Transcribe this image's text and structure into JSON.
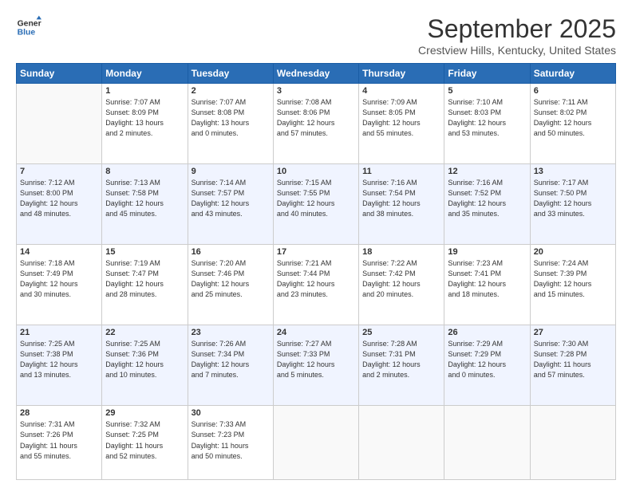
{
  "header": {
    "logo_line1": "General",
    "logo_line2": "Blue",
    "month": "September 2025",
    "location": "Crestview Hills, Kentucky, United States"
  },
  "weekdays": [
    "Sunday",
    "Monday",
    "Tuesday",
    "Wednesday",
    "Thursday",
    "Friday",
    "Saturday"
  ],
  "weeks": [
    [
      {
        "day": "",
        "info": ""
      },
      {
        "day": "1",
        "info": "Sunrise: 7:07 AM\nSunset: 8:09 PM\nDaylight: 13 hours\nand 2 minutes."
      },
      {
        "day": "2",
        "info": "Sunrise: 7:07 AM\nSunset: 8:08 PM\nDaylight: 13 hours\nand 0 minutes."
      },
      {
        "day": "3",
        "info": "Sunrise: 7:08 AM\nSunset: 8:06 PM\nDaylight: 12 hours\nand 57 minutes."
      },
      {
        "day": "4",
        "info": "Sunrise: 7:09 AM\nSunset: 8:05 PM\nDaylight: 12 hours\nand 55 minutes."
      },
      {
        "day": "5",
        "info": "Sunrise: 7:10 AM\nSunset: 8:03 PM\nDaylight: 12 hours\nand 53 minutes."
      },
      {
        "day": "6",
        "info": "Sunrise: 7:11 AM\nSunset: 8:02 PM\nDaylight: 12 hours\nand 50 minutes."
      }
    ],
    [
      {
        "day": "7",
        "info": "Sunrise: 7:12 AM\nSunset: 8:00 PM\nDaylight: 12 hours\nand 48 minutes."
      },
      {
        "day": "8",
        "info": "Sunrise: 7:13 AM\nSunset: 7:58 PM\nDaylight: 12 hours\nand 45 minutes."
      },
      {
        "day": "9",
        "info": "Sunrise: 7:14 AM\nSunset: 7:57 PM\nDaylight: 12 hours\nand 43 minutes."
      },
      {
        "day": "10",
        "info": "Sunrise: 7:15 AM\nSunset: 7:55 PM\nDaylight: 12 hours\nand 40 minutes."
      },
      {
        "day": "11",
        "info": "Sunrise: 7:16 AM\nSunset: 7:54 PM\nDaylight: 12 hours\nand 38 minutes."
      },
      {
        "day": "12",
        "info": "Sunrise: 7:16 AM\nSunset: 7:52 PM\nDaylight: 12 hours\nand 35 minutes."
      },
      {
        "day": "13",
        "info": "Sunrise: 7:17 AM\nSunset: 7:50 PM\nDaylight: 12 hours\nand 33 minutes."
      }
    ],
    [
      {
        "day": "14",
        "info": "Sunrise: 7:18 AM\nSunset: 7:49 PM\nDaylight: 12 hours\nand 30 minutes."
      },
      {
        "day": "15",
        "info": "Sunrise: 7:19 AM\nSunset: 7:47 PM\nDaylight: 12 hours\nand 28 minutes."
      },
      {
        "day": "16",
        "info": "Sunrise: 7:20 AM\nSunset: 7:46 PM\nDaylight: 12 hours\nand 25 minutes."
      },
      {
        "day": "17",
        "info": "Sunrise: 7:21 AM\nSunset: 7:44 PM\nDaylight: 12 hours\nand 23 minutes."
      },
      {
        "day": "18",
        "info": "Sunrise: 7:22 AM\nSunset: 7:42 PM\nDaylight: 12 hours\nand 20 minutes."
      },
      {
        "day": "19",
        "info": "Sunrise: 7:23 AM\nSunset: 7:41 PM\nDaylight: 12 hours\nand 18 minutes."
      },
      {
        "day": "20",
        "info": "Sunrise: 7:24 AM\nSunset: 7:39 PM\nDaylight: 12 hours\nand 15 minutes."
      }
    ],
    [
      {
        "day": "21",
        "info": "Sunrise: 7:25 AM\nSunset: 7:38 PM\nDaylight: 12 hours\nand 13 minutes."
      },
      {
        "day": "22",
        "info": "Sunrise: 7:25 AM\nSunset: 7:36 PM\nDaylight: 12 hours\nand 10 minutes."
      },
      {
        "day": "23",
        "info": "Sunrise: 7:26 AM\nSunset: 7:34 PM\nDaylight: 12 hours\nand 7 minutes."
      },
      {
        "day": "24",
        "info": "Sunrise: 7:27 AM\nSunset: 7:33 PM\nDaylight: 12 hours\nand 5 minutes."
      },
      {
        "day": "25",
        "info": "Sunrise: 7:28 AM\nSunset: 7:31 PM\nDaylight: 12 hours\nand 2 minutes."
      },
      {
        "day": "26",
        "info": "Sunrise: 7:29 AM\nSunset: 7:29 PM\nDaylight: 12 hours\nand 0 minutes."
      },
      {
        "day": "27",
        "info": "Sunrise: 7:30 AM\nSunset: 7:28 PM\nDaylight: 11 hours\nand 57 minutes."
      }
    ],
    [
      {
        "day": "28",
        "info": "Sunrise: 7:31 AM\nSunset: 7:26 PM\nDaylight: 11 hours\nand 55 minutes."
      },
      {
        "day": "29",
        "info": "Sunrise: 7:32 AM\nSunset: 7:25 PM\nDaylight: 11 hours\nand 52 minutes."
      },
      {
        "day": "30",
        "info": "Sunrise: 7:33 AM\nSunset: 7:23 PM\nDaylight: 11 hours\nand 50 minutes."
      },
      {
        "day": "",
        "info": ""
      },
      {
        "day": "",
        "info": ""
      },
      {
        "day": "",
        "info": ""
      },
      {
        "day": "",
        "info": ""
      }
    ]
  ]
}
